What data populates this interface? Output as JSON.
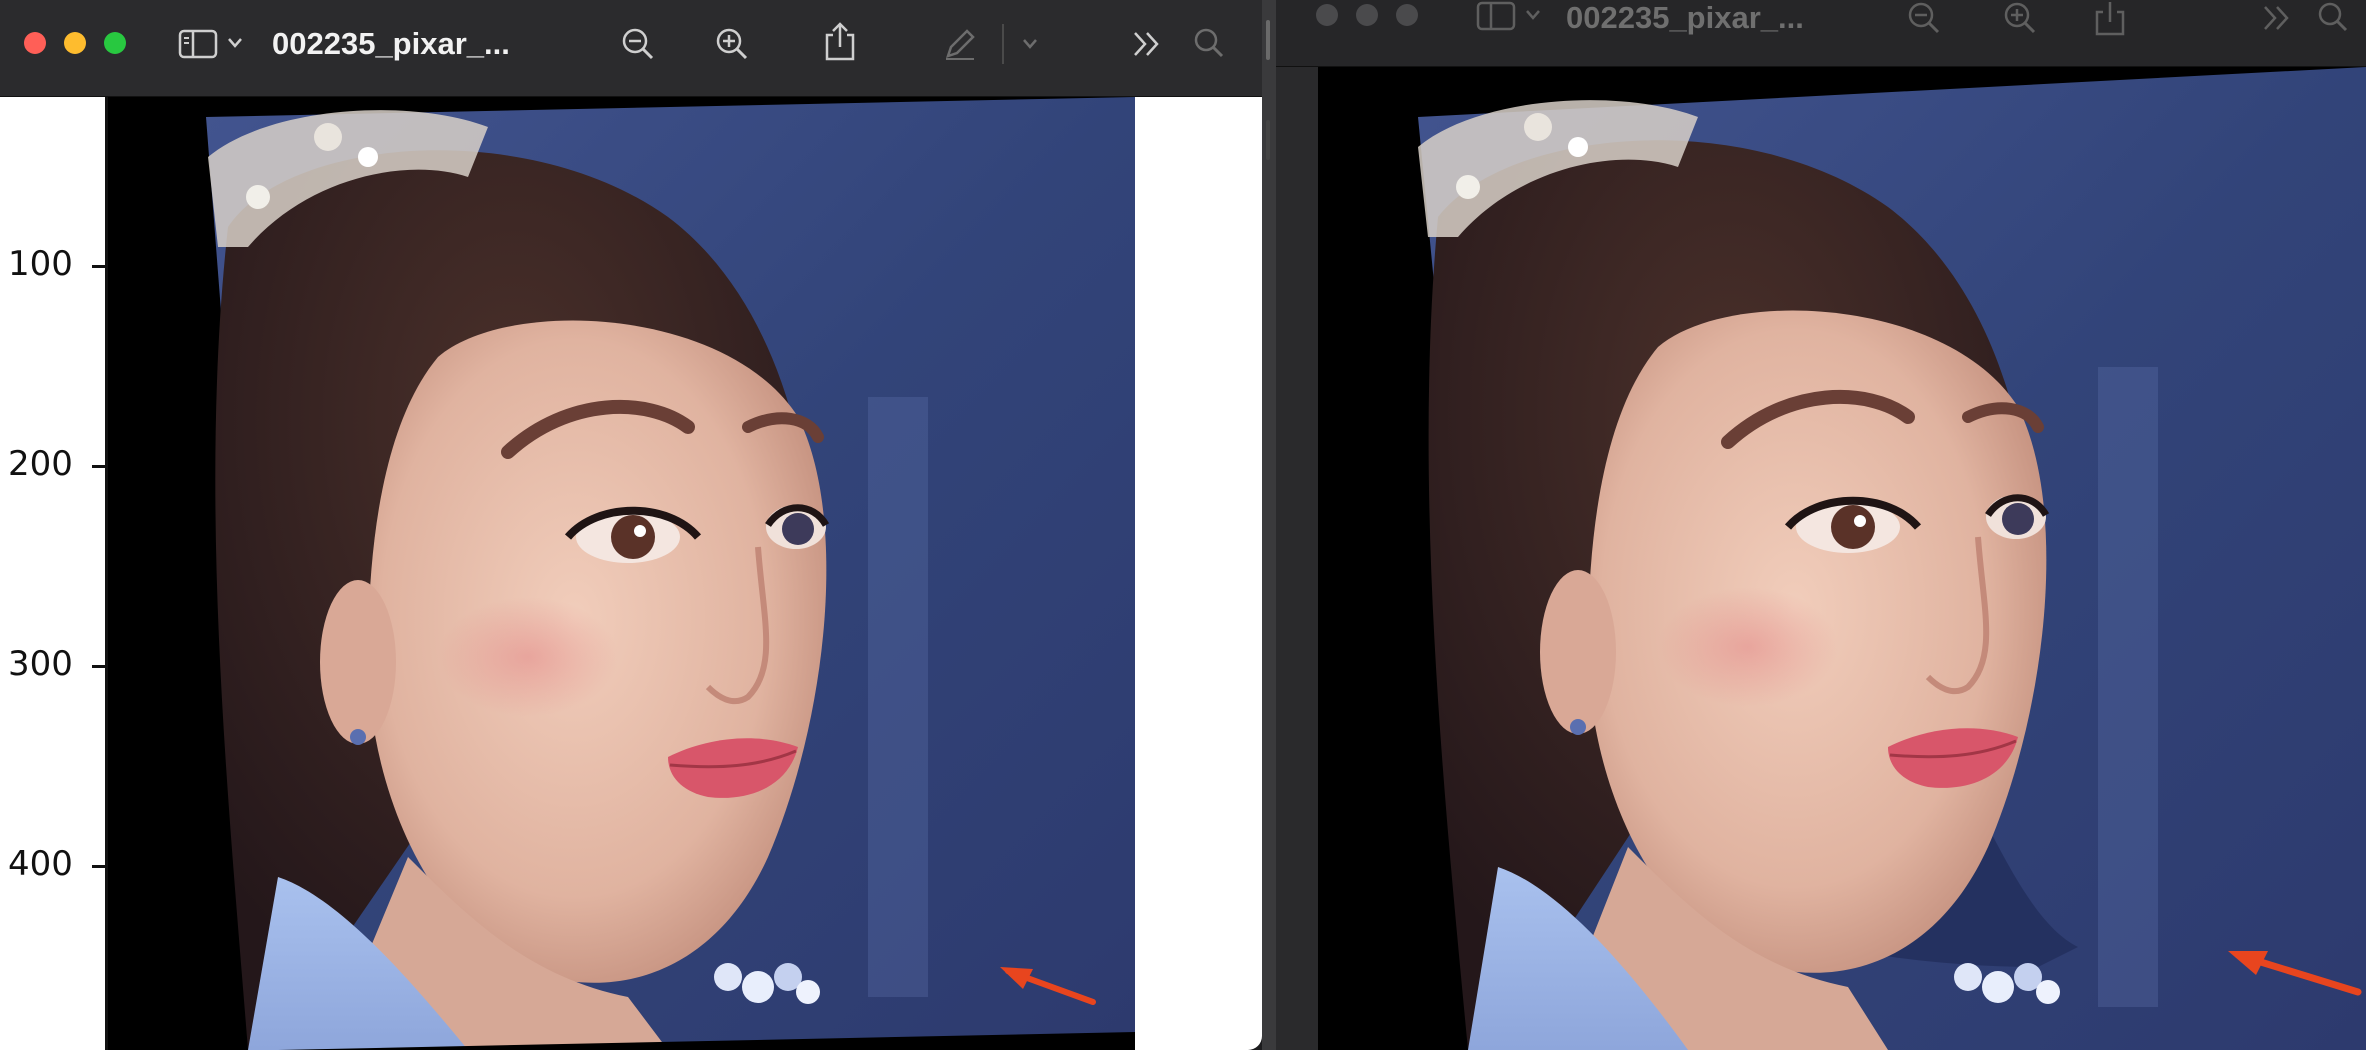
{
  "left_window": {
    "title": "002235_pixar_...",
    "active": true,
    "toolbar_icons": [
      "sidebar-icon",
      "chevron-down-icon",
      "zoom-out-icon",
      "zoom-in-icon",
      "share-icon",
      "markup-pen-icon",
      "chevron-down-icon",
      "more-icon",
      "search-icon"
    ]
  },
  "right_window": {
    "title": "002235_pixar_...",
    "active": false,
    "toolbar_icons": [
      "sidebar-icon",
      "chevron-down-icon",
      "zoom-out-icon",
      "zoom-in-icon",
      "share-icon",
      "more-icon",
      "search-icon"
    ]
  },
  "y_axis": {
    "ticks": [
      "100",
      "200",
      "300",
      "400"
    ]
  },
  "colors": {
    "traffic_close": "#ff5f57",
    "traffic_min": "#febc2e",
    "traffic_max": "#28c840",
    "traffic_inactive": "#4a4a4c",
    "arrow": "#e8451e",
    "background_blue": "#3b4a86"
  }
}
